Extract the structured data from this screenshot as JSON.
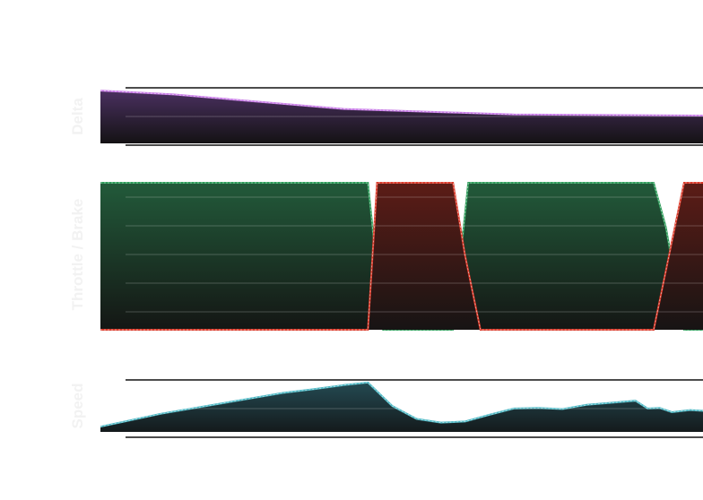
{
  "chart_data": [
    {
      "type": "area",
      "ylabel": "Delta",
      "color": "#c77be6",
      "fill_top": "#4a3060",
      "fill_bottom": "#141214",
      "x": [
        0,
        0.12,
        0.4,
        0.68,
        1.0
      ],
      "values": [
        0.95,
        0.88,
        0.62,
        0.52,
        0.5
      ],
      "ylim": [
        0,
        1
      ],
      "grid": true
    },
    {
      "type": "area",
      "ylabel": "Throttle / Brake",
      "ylim": [
        0,
        100
      ],
      "grid": true,
      "series": [
        {
          "color": "#2e9b5a",
          "fill_top": "#225a3a",
          "fill_bottom": "#141614",
          "x": [
            0,
            0.44,
            0.465,
            0.58,
            0.605,
            0.62,
            0.91,
            0.93,
            0.96,
            1.0
          ],
          "values": [
            100,
            100,
            0,
            0,
            100,
            100,
            100,
            70,
            0,
            0
          ]
        },
        {
          "color": "#d93a2a",
          "fill_top": "#5c1c16",
          "fill_bottom": "#171414",
          "x": [
            0,
            0.44,
            0.455,
            0.58,
            0.6,
            0.625,
            0.91,
            0.945,
            0.96,
            1.0
          ],
          "values": [
            0,
            0,
            100,
            100,
            50,
            0,
            0,
            70,
            100,
            100
          ]
        }
      ]
    },
    {
      "type": "area",
      "ylabel": "Speed",
      "color": "#4fb8c4",
      "fill_top": "#244a52",
      "fill_bottom": "#141a1c",
      "x": [
        0,
        0.1,
        0.2,
        0.3,
        0.35,
        0.4,
        0.44,
        0.48,
        0.52,
        0.56,
        0.6,
        0.64,
        0.68,
        0.72,
        0.76,
        0.8,
        0.84,
        0.88,
        0.9,
        0.92,
        0.94,
        0.97,
        1.0
      ],
      "values": [
        0.1,
        0.35,
        0.55,
        0.75,
        0.82,
        0.9,
        0.95,
        0.5,
        0.25,
        0.18,
        0.2,
        0.33,
        0.45,
        0.46,
        0.44,
        0.52,
        0.56,
        0.6,
        0.45,
        0.46,
        0.38,
        0.42,
        0.4
      ],
      "ylim": [
        0,
        1
      ],
      "grid": true
    }
  ]
}
